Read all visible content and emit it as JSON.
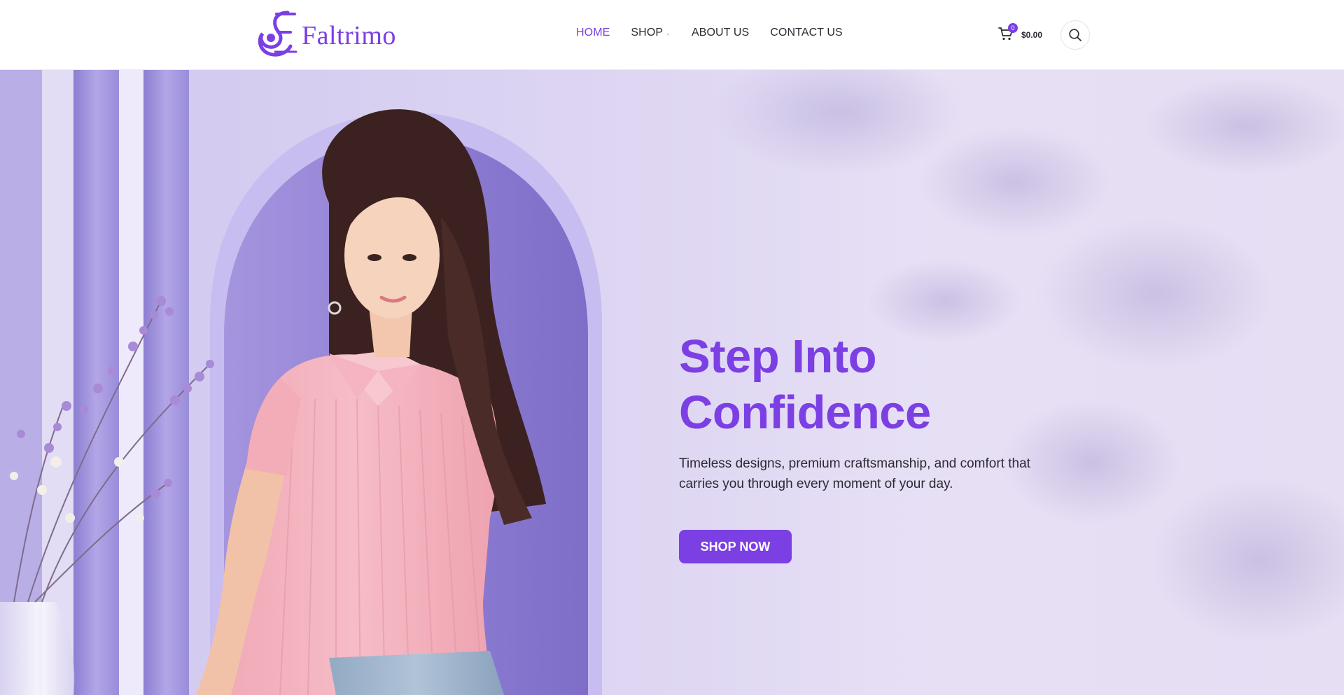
{
  "header": {
    "logo_text": "Faltrimo",
    "nav": [
      {
        "label": "HOME",
        "active": true
      },
      {
        "label": "SHOP",
        "has_dropdown": true
      },
      {
        "label": "ABOUT US"
      },
      {
        "label": "CONTACT US"
      }
    ],
    "cart": {
      "count": "0",
      "total": "$0.00",
      "icon": "cart-icon"
    },
    "search_icon": "search-icon"
  },
  "hero": {
    "title": "Step Into Confidence",
    "subtitle": "Timeless designs, premium craftsmanship, and comfort that carries you through every moment of your day.",
    "cta_label": "SHOP NOW"
  },
  "colors": {
    "accent": "#7b3fe4",
    "text": "#2a2a33",
    "hero_bg": "#ddd5f2"
  }
}
